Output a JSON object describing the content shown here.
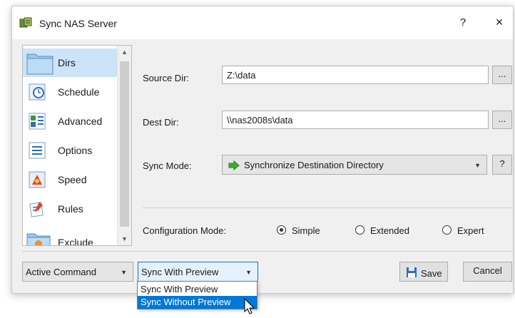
{
  "window": {
    "title": "Sync NAS Server",
    "help": "?",
    "close": "×"
  },
  "sidebar": {
    "items": [
      {
        "label": "Dirs",
        "icon": "folder-icon",
        "selected": true
      },
      {
        "label": "Schedule",
        "icon": "clock-icon"
      },
      {
        "label": "Advanced",
        "icon": "advanced-list-icon"
      },
      {
        "label": "Options",
        "icon": "options-list-icon"
      },
      {
        "label": "Speed",
        "icon": "speed-icon"
      },
      {
        "label": "Rules",
        "icon": "rules-icon"
      },
      {
        "label": "Exclude",
        "icon": "exclude-folder-icon"
      }
    ]
  },
  "form": {
    "source_label": "Source Dir:",
    "source_value": "Z:\\data",
    "dest_label": "Dest Dir:",
    "dest_value": "\\\\nas2008s\\data",
    "browse": "...",
    "sync_mode_label": "Sync Mode:",
    "sync_mode_value": "Synchronize Destination Directory",
    "sync_mode_help": "?",
    "config_label": "Configuration Mode:",
    "config_options": [
      {
        "label": "Simple",
        "selected": true
      },
      {
        "label": "Extended",
        "selected": false
      },
      {
        "label": "Expert",
        "selected": false
      }
    ]
  },
  "footer": {
    "active_command": "Active Command",
    "sync_preview": "Sync With Preview",
    "save": "Save",
    "cancel": "Cancel"
  },
  "dropdown": {
    "options": [
      {
        "label": "Sync With Preview",
        "highlighted": false
      },
      {
        "label": "Sync Without Preview",
        "highlighted": true
      }
    ]
  },
  "colors": {
    "accent": "#0078d7",
    "selection": "#cce4f7",
    "go_arrow": "#3fae29"
  }
}
